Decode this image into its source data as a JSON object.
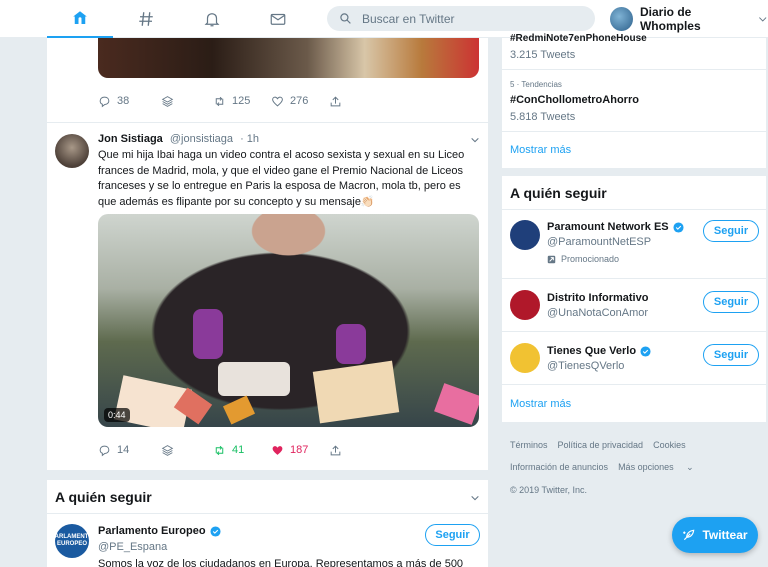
{
  "nav": {
    "tabs": [
      {
        "name": "home-icon",
        "active": true
      },
      {
        "name": "explore-hash-icon",
        "active": false
      },
      {
        "name": "notifications-bell-icon",
        "active": false
      },
      {
        "name": "messages-mail-icon",
        "active": false
      }
    ],
    "search_placeholder": "Buscar en Twitter",
    "account_name": "Diario de Whomples"
  },
  "timeline": {
    "prev_tweet_actions": {
      "replies": "38",
      "retweets": "125",
      "likes": "276"
    },
    "tweet": {
      "name": "Jon Sistiaga",
      "handle": "@jonsistiaga",
      "time": "· 1h",
      "text": "Que mi hija Ibai haga un video contra el acoso sexista y sexual en su Liceo frances de Madrid, mola, y que el video gane el Premio Nacional de Liceos franceses y se lo entregue en Paris la esposa de Macron, mola tb, pero es que además es flipante por su concepto y su mensaje👏🏻",
      "video_duration": "0:44",
      "replies": "14",
      "retweets": "41",
      "likes": "187"
    },
    "who_to_follow": {
      "title": "A quién seguir",
      "account": {
        "name": "Parlamento Europeo",
        "handle": "@PE_Espana",
        "avatar_text": "PARLAMENTO EUROPEO",
        "desc": "Somos la voz de los ciudadanos en Europa. Representamos a más de 500"
      },
      "follow_label": "Seguir"
    }
  },
  "sidebar": {
    "trends": [
      {
        "meta": "",
        "tag": "#RedmiNote7enPhoneHouse",
        "count": "3.215 Tweets"
      },
      {
        "meta": "5 · Tendencias",
        "tag": "#ConChollometroAhorro",
        "count": "5.818 Tweets"
      }
    ],
    "more_label": "Mostrar más",
    "who_to_follow": {
      "title": "A quién seguir",
      "accounts": [
        {
          "name": "Paramount Network ES",
          "handle": "@ParamountNetESP",
          "verified": true,
          "promo": "Promocionado",
          "color": "#1f3f7a"
        },
        {
          "name": "Distrito Informativo",
          "handle": "@UnaNotaConAmor",
          "verified": false,
          "promo": "",
          "color": "#b0182a"
        },
        {
          "name": "Tienes Que Verlo",
          "handle": "@TienesQVerlo",
          "verified": true,
          "promo": "",
          "color": "#f1c232"
        }
      ],
      "follow_label": "Seguir",
      "more_label": "Mostrar más"
    },
    "footer": {
      "links": [
        "Términos",
        "Política de privacidad",
        "Cookies",
        "Información de anuncios",
        "Más opciones"
      ],
      "copyright": "© 2019 Twitter, Inc."
    }
  },
  "tweet_button_label": "Twittear",
  "colors": {
    "accent": "#1da1f2",
    "retweet": "#17bf63",
    "like": "#e0245e",
    "background": "#e6ecf0"
  }
}
